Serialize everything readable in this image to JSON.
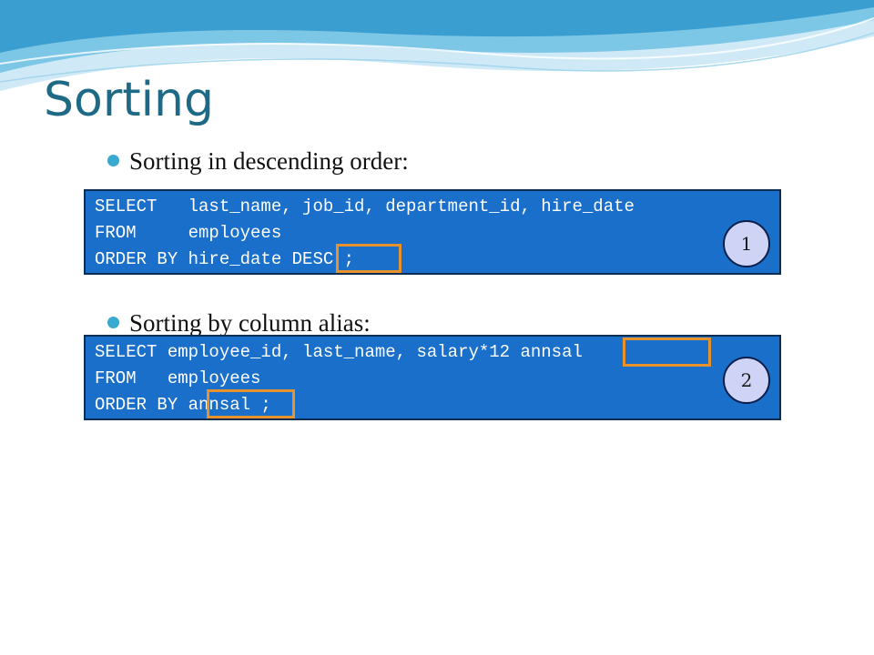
{
  "slide": {
    "title": "Sorting",
    "bullets": [
      "Sorting in descending order:",
      "Sorting by column alias:"
    ]
  },
  "example1": {
    "lines": [
      "SELECT   last_name, job_id, department_id, hire_date",
      "FROM     employees",
      "ORDER BY hire_date DESC ;"
    ],
    "highlight": "DESC",
    "badge": "1"
  },
  "example2": {
    "lines": [
      "SELECT employee_id, last_name, salary*12 annsal",
      "FROM   employees",
      "ORDER BY annsal ;"
    ],
    "highlights": [
      "annsal",
      "annsal"
    ],
    "badge": "2"
  },
  "colors": {
    "title": "#1e6a86",
    "bullet": "#39a9d0",
    "code_bg": "#1a6fcb",
    "highlight": "#e8922c",
    "badge_bg": "#cfd3f6"
  }
}
